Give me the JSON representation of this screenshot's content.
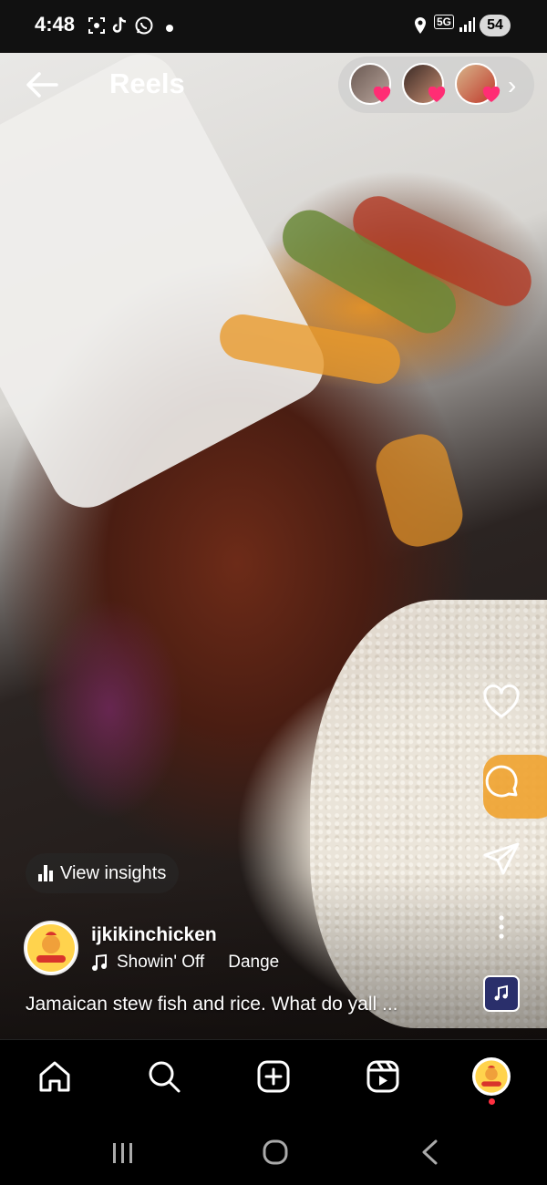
{
  "status_bar": {
    "time": "4:48",
    "network": "5G",
    "battery": "54",
    "icons": [
      "screenshot-icon",
      "tiktok-icon",
      "whatsapp-icon",
      "notification-dot-icon",
      "location-icon",
      "signal-icon"
    ]
  },
  "header": {
    "title": "Reels",
    "back_icon": "back-arrow-icon",
    "stories_chevron": "›"
  },
  "video": {
    "insights_label": "View insights"
  },
  "author": {
    "username": "ijkikinchicken",
    "audio": {
      "track": "Showin' Off",
      "artist": "Dange"
    },
    "caption": "Jamaican stew fish and rice. What do yall ..."
  },
  "actions": [
    "heart-icon",
    "comment-icon",
    "share-icon",
    "more-icon",
    "audio-icon"
  ],
  "bottom_nav": [
    "home-icon",
    "search-icon",
    "create-icon",
    "reels-icon",
    "profile-icon"
  ],
  "system_nav": [
    "recents-icon",
    "home-button-icon",
    "back-button-icon"
  ],
  "colors": {
    "notification_dot": "#ff3040",
    "heart_badge": "#ff2d74",
    "background": "#000000"
  }
}
